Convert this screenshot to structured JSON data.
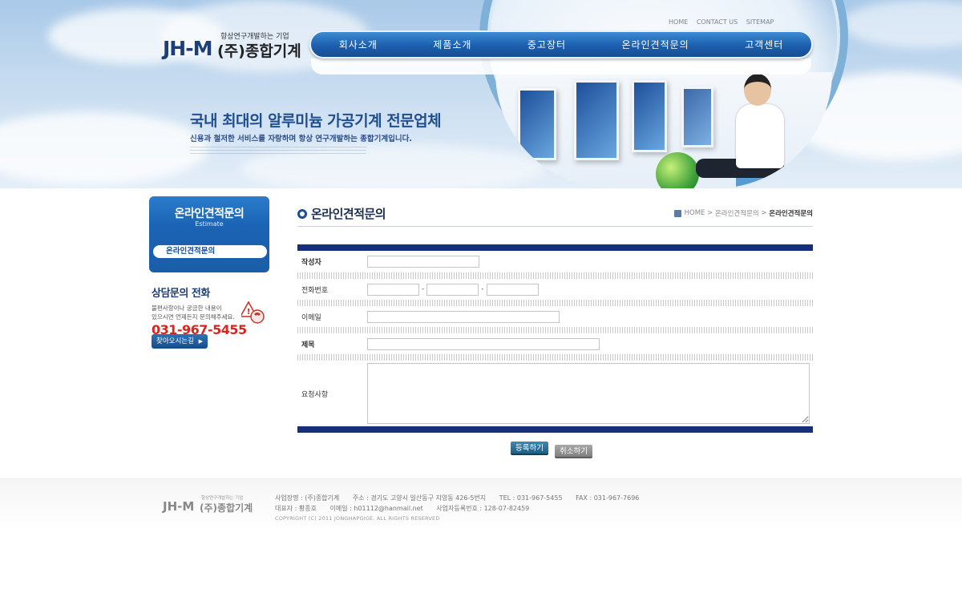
{
  "header": {
    "logo_tagline": "항상연구개발하는 기업",
    "logo_mark": "JH-M",
    "logo_company": "(주)종합기계",
    "top_menu": [
      "HOME",
      "CONTACT US",
      "SITEMAP"
    ],
    "nav": [
      "회사소개",
      "제품소개",
      "중고장터",
      "온라인견적문의",
      "고객센터"
    ],
    "slogan_main": "국내 최대의 알루미늄 가공기계 전문업체",
    "slogan_sub": "신용과 철저한 서비스를 자랑하며 항상 연구개발하는 종합기계입니다."
  },
  "sidebar": {
    "title": "온라인견적문의",
    "subtitle": "Estimate",
    "menu_item": "온라인견적문의",
    "phone_heading": "상담문의 전화",
    "phone_desc_1": "불편사항이나 궁금한 내용이",
    "phone_desc_2": "있으시면 언제든지 문의해주세요.",
    "phone_number": "031-967-5455",
    "direction_button": "찾아오시는길"
  },
  "content": {
    "title": "온라인견적문의",
    "breadcrumb": {
      "home": "HOME",
      "sep": ">",
      "parent": "온라인견적문의",
      "current": "온라인견적문의"
    },
    "form": {
      "author_label": "작성자",
      "phone_label": "전화번호",
      "phone_dash": "-",
      "email_label": "이메일",
      "subject_label": "제목",
      "request_label": "요청사항",
      "author_value": "",
      "email_value": "",
      "subject_value": "",
      "request_value": ""
    },
    "submit_button": "등록하기",
    "cancel_button": "취소하기"
  },
  "footer": {
    "logo_tagline": "항상연구개발하는 기업",
    "logo_mark": "JH-M",
    "logo_company": "(주)종합기계",
    "line1_company": "사업장명 : (주)종합기계",
    "line1_address": "주소 : 경기도 고양시 일산동구 지영동 426-5번지",
    "line1_tel": "TEL : 031-967-5455",
    "line1_fax": "FAX : 031-967-7696",
    "line2_ceo": "대표자 : 황종호",
    "line2_email": "이메일 : h01112@hanmail.net",
    "line2_bizno": "사업자등록번호 : 128-07-82459",
    "copyright": "COPYRIGHT (C) 2011 JONGHAPGIGE. ALL RIGHTS RESERVED"
  },
  "colors": {
    "nav_blue": "#1b5fae",
    "form_bar": "#152f7b",
    "phone_red": "#d8261e",
    "title_dark": "#1c3050"
  },
  "icons": [
    "home-icon",
    "phone-icon",
    "arrow-right-icon",
    "bullet-circle-icon"
  ]
}
